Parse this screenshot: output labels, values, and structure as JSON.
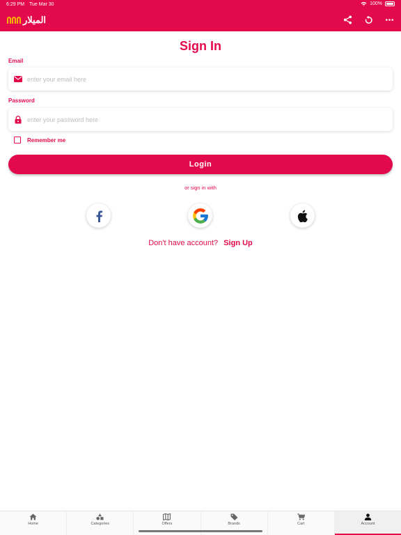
{
  "status": {
    "time": "6:29 PM",
    "date": "Tue Mar 30",
    "battery": "100%"
  },
  "header": {
    "logo_text": "الميلار",
    "icons": [
      "share-icon",
      "refresh-icon",
      "more-icon"
    ],
    "color": "#e30a4b"
  },
  "form": {
    "title": "Sign In",
    "email_label": "Email",
    "email_placeholder": "enter your email here",
    "password_label": "Password",
    "password_placeholder": "enter your password here",
    "remember_label": "Remember me",
    "login_label": "Login",
    "or_text": "or sign in with",
    "no_account_text": "Don't have account?",
    "signup_label": "Sign Up"
  },
  "social": [
    "facebook-icon",
    "google-icon",
    "apple-icon"
  ],
  "tabs": [
    {
      "label": "Home",
      "icon": "home-icon"
    },
    {
      "label": "Categories",
      "icon": "categories-icon"
    },
    {
      "label": "Offers",
      "icon": "offers-icon"
    },
    {
      "label": "Brands",
      "icon": "brands-icon"
    },
    {
      "label": "Cart",
      "icon": "cart-icon"
    },
    {
      "label": "Account",
      "icon": "account-icon",
      "active": true
    }
  ]
}
